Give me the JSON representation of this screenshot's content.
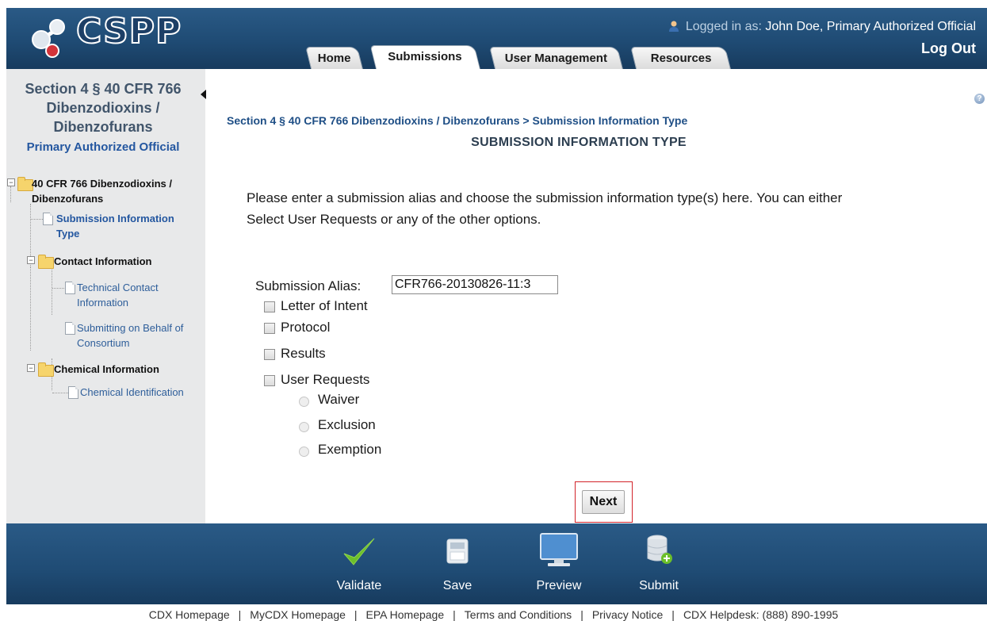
{
  "app": {
    "logo_text": "CSPP"
  },
  "header": {
    "logged_in_label": "Logged in as:",
    "user": "John Doe, Primary Authorized Official",
    "logout": "Log Out"
  },
  "nav": {
    "tabs": [
      {
        "label": "Home"
      },
      {
        "label": "Submissions"
      },
      {
        "label": "User Management"
      },
      {
        "label": "Resources"
      }
    ],
    "active_tab": "Submissions"
  },
  "sidebar": {
    "title": "Section 4 § 40 CFR 766 Dibenzodioxins / Dibenzofurans",
    "role": "Primary Authorized Official",
    "tree": {
      "root": "40 CFR 766 Dibenzodioxins / Dibenzofurans",
      "submission_info": "Submission Information Type",
      "contact_folder": "Contact Information",
      "technical_contact": "Technical Contact Information",
      "consortium": "Submitting on Behalf of Consortium",
      "chemical_folder": "Chemical Information",
      "chemical_id": "Chemical Identification"
    }
  },
  "main": {
    "breadcrumb": "Section 4 § 40 CFR 766 Dibenzodioxins / Dibenzofurans > Submission Information Type",
    "title": "SUBMISSION INFORMATION TYPE",
    "intro_line1": "Please enter a submission alias and choose the submission information type(s) here. You can either",
    "intro_line2": "Select User Requests or any of the other options.",
    "alias_label": "Submission Alias:",
    "alias_value": "CFR766-20130826-11:3",
    "checkboxes": [
      "Letter of Intent",
      "Protocol",
      "Results",
      "User Requests"
    ],
    "radios": [
      "Waiver",
      "Exclusion",
      "Exemption"
    ],
    "next_label": "Next"
  },
  "toolbar": {
    "validate": "Validate",
    "save": "Save",
    "preview": "Preview",
    "submit": "Submit"
  },
  "footer_links": [
    "CDX Homepage",
    "MyCDX Homepage",
    "EPA Homepage",
    "Terms and Conditions",
    "Privacy Notice",
    "CDX Helpdesk: (888) 890-1995"
  ],
  "colors": {
    "header_blue": "#1f4b74",
    "sidebar_bg": "#e8e9ea",
    "link_blue": "#2457a0",
    "highlight_red": "#d2232a",
    "validate_green": "#6cbf2a"
  }
}
